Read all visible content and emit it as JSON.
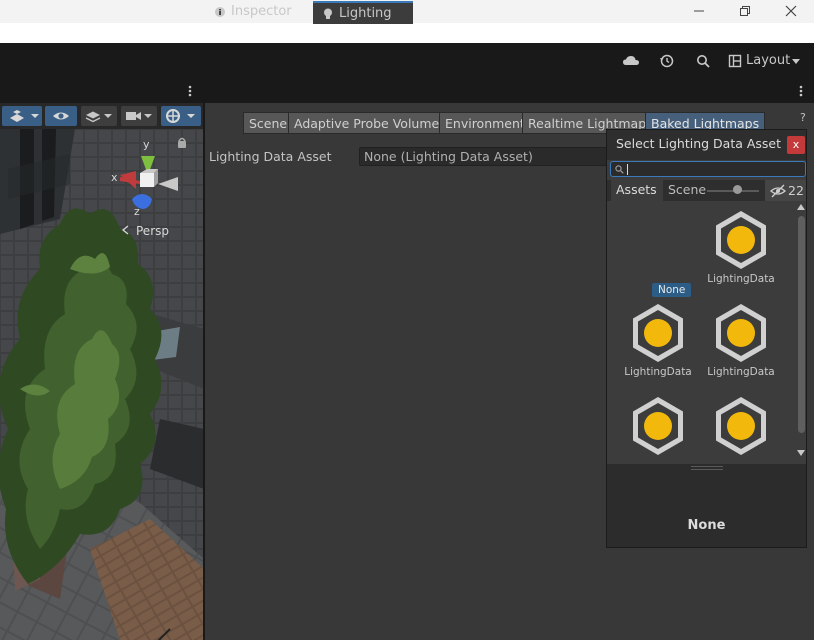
{
  "toolbar": {
    "layout_label": "Layout"
  },
  "tabs": {
    "inspector_label": "Inspector",
    "lighting_label": "Lighting"
  },
  "scene_view": {
    "projection_label": "Persp",
    "axis_y": "y",
    "axis_x": "x",
    "axis_z": "z"
  },
  "lighting": {
    "tabs": [
      "Scene",
      "Adaptive Probe Volumes",
      "Environment",
      "Realtime Lightmaps",
      "Baked Lightmaps"
    ],
    "active_tab": "Baked Lightmaps",
    "field_label": "Lighting Data Asset",
    "field_value": "None (Lighting Data Asset)",
    "help_glyph": "?"
  },
  "picker": {
    "title": "Select Lighting Data Asset",
    "close_glyph": "x",
    "search_value": "",
    "tabs": {
      "assets": "Assets",
      "scene": "Scene"
    },
    "hidden_count": "22",
    "items": [
      {
        "label": "None",
        "selected": true
      },
      {
        "label": "LightingData"
      },
      {
        "label": "LightingData"
      },
      {
        "label": "LightingData"
      },
      {
        "label": ""
      },
      {
        "label": ""
      }
    ],
    "preview_name": "None"
  },
  "colors": {
    "accent": "#3a79bb",
    "selection": "#2c5d87",
    "close": "#c43a3a",
    "asset_icon": "#f2b90c"
  }
}
